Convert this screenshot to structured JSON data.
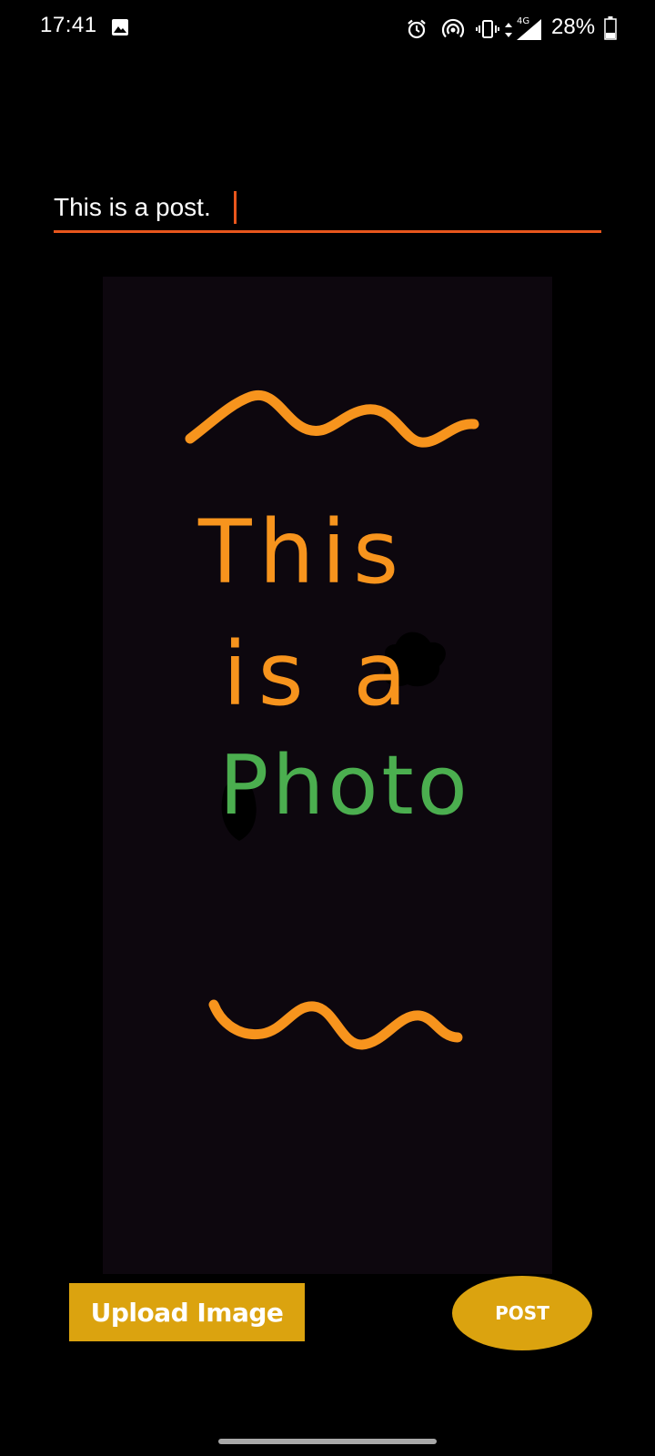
{
  "status_bar": {
    "time": "17:41",
    "network": "4G",
    "battery_percent": "28%",
    "battery_level": 0.28,
    "icons": [
      "gallery-icon",
      "alarm-icon",
      "hotspot-icon",
      "vibrate-icon",
      "data-arrows-icon",
      "signal-icon",
      "battery-icon"
    ]
  },
  "composer": {
    "post_text": "This is a post.",
    "accent_color": "#e8561c"
  },
  "photo": {
    "line1": "This",
    "line2": "is a",
    "line3": "Photo",
    "orange": "#f7941d",
    "green": "#4bae4f",
    "background": "#0d070e"
  },
  "actions": {
    "upload_label": "Upload Image",
    "post_label": "POST",
    "button_color": "#dba30f"
  }
}
